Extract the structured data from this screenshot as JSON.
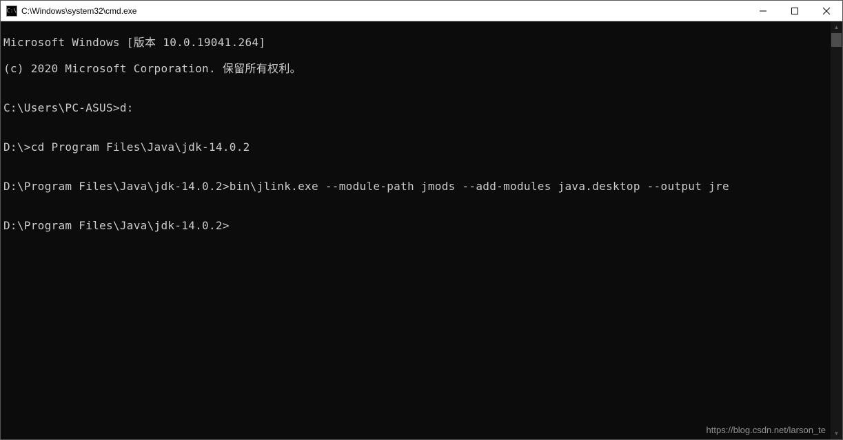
{
  "window": {
    "icon_text": "C:\\",
    "title": "C:\\Windows\\system32\\cmd.exe"
  },
  "terminal": {
    "lines": [
      "Microsoft Windows [版本 10.0.19041.264]",
      "(c) 2020 Microsoft Corporation. 保留所有权利。",
      "",
      "C:\\Users\\PC-ASUS>d:",
      "",
      "D:\\>cd Program Files\\Java\\jdk-14.0.2",
      "",
      "D:\\Program Files\\Java\\jdk-14.0.2>bin\\jlink.exe --module-path jmods --add-modules java.desktop --output jre",
      "",
      "D:\\Program Files\\Java\\jdk-14.0.2>"
    ]
  },
  "watermark": "https://blog.csdn.net/larson_te"
}
